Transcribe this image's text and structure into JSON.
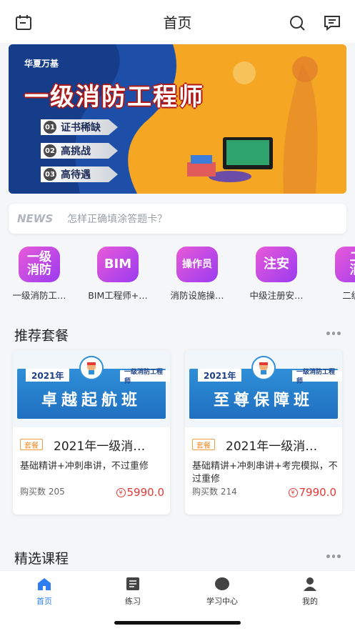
{
  "header": {
    "title": "首页"
  },
  "banner": {
    "brand": "华夏万基",
    "title": "一级消防工程师",
    "points": [
      {
        "num": "01",
        "label": "证书稀缺"
      },
      {
        "num": "02",
        "label": "高挑战"
      },
      {
        "num": "03",
        "label": "高待遇"
      }
    ]
  },
  "news": {
    "tag": "NEWS",
    "text": "怎样正确填涂答题卡？"
  },
  "categories": [
    {
      "icon_text": "一级\n消防",
      "label": "一级消防工…"
    },
    {
      "icon_text": "BIM",
      "label": "BIM工程师+…"
    },
    {
      "icon_text": "操作员",
      "label": "消防设施操…"
    },
    {
      "icon_text": "注安",
      "label": "中级注册安…"
    },
    {
      "icon_text": "二\n消",
      "label": "二级消"
    }
  ],
  "sections": {
    "recommended": "推荐套餐",
    "selected": "精选课程"
  },
  "packages": [
    {
      "year": "2021年",
      "kind": "一级消防工程师",
      "class_name": "卓越起航班",
      "badge": "套餐",
      "title": "2021年一级消…",
      "desc": "基础精讲+冲刺串讲，不过重修",
      "buys": "购买数 205",
      "price": "5990.0"
    },
    {
      "year": "2021年",
      "kind": "一级消防工程师",
      "class_name": "至尊保障班",
      "badge": "套餐",
      "title": "2021年一级消…",
      "desc": "基础精讲+冲刺串讲+考完模拟，不过重修",
      "buys": "购买数 214",
      "price": "7990.0"
    }
  ],
  "nav": [
    {
      "label": "首页",
      "active": true
    },
    {
      "label": "练习"
    },
    {
      "label": "学习中心"
    },
    {
      "label": "我的"
    }
  ],
  "colors": {
    "accent": "#2f7ef0",
    "price": "#e53935",
    "banner": "#f5a623",
    "category_gradient": [
      "#e85ad8",
      "#9b3bf0"
    ]
  }
}
